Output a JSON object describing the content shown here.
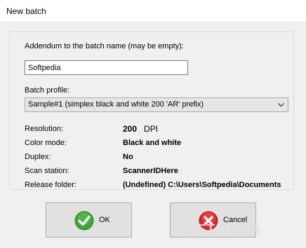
{
  "window": {
    "title": "New batch"
  },
  "addendum": {
    "label": "Addendum to the batch name (may be empty):",
    "value": "Softpedia"
  },
  "profile": {
    "label": "Batch profile:",
    "selected": "Sample#1 (simplex black and white 200 'AR' prefix)"
  },
  "info": {
    "resolution_label": "Resolution:",
    "resolution_value": "200",
    "resolution_unit": "DPI",
    "color_mode_label": "Color mode:",
    "color_mode_value": "Black and white",
    "duplex_label": "Duplex:",
    "duplex_value": "No",
    "scan_station_label": "Scan station:",
    "scan_station_value": "ScannerIDHere",
    "release_folder_label": "Release folder:",
    "release_folder_value": "(Undefined) C:\\Users\\Softpedia\\Documents"
  },
  "buttons": {
    "ok": "OK",
    "cancel": "Cancel"
  },
  "watermark": "SOFTPEDIA",
  "colors": {
    "ok_green": "#3fa535",
    "cancel_red": "#d9262b"
  }
}
